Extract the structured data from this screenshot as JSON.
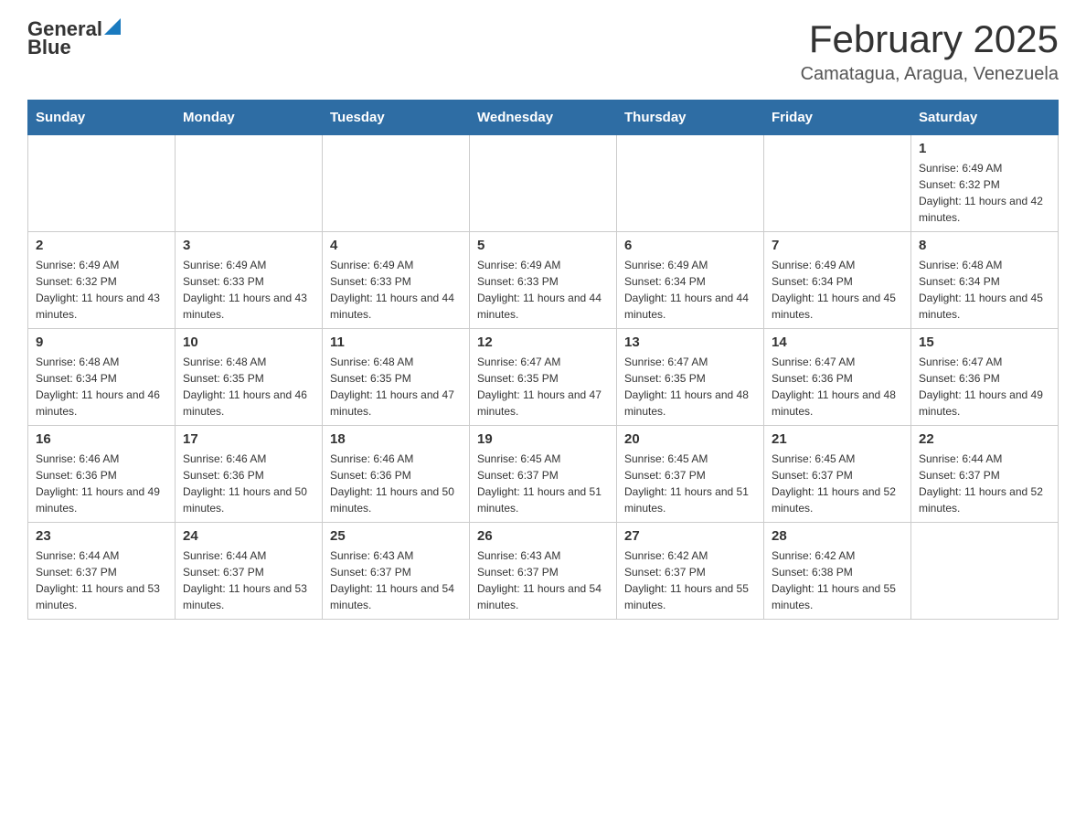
{
  "header": {
    "logo_text_general": "General",
    "logo_text_blue": "Blue",
    "title": "February 2025",
    "location": "Camatagua, Aragua, Venezuela"
  },
  "weekdays": [
    "Sunday",
    "Monday",
    "Tuesday",
    "Wednesday",
    "Thursday",
    "Friday",
    "Saturday"
  ],
  "weeks": [
    [
      {
        "day": "",
        "info": ""
      },
      {
        "day": "",
        "info": ""
      },
      {
        "day": "",
        "info": ""
      },
      {
        "day": "",
        "info": ""
      },
      {
        "day": "",
        "info": ""
      },
      {
        "day": "",
        "info": ""
      },
      {
        "day": "1",
        "info": "Sunrise: 6:49 AM\nSunset: 6:32 PM\nDaylight: 11 hours and 42 minutes."
      }
    ],
    [
      {
        "day": "2",
        "info": "Sunrise: 6:49 AM\nSunset: 6:32 PM\nDaylight: 11 hours and 43 minutes."
      },
      {
        "day": "3",
        "info": "Sunrise: 6:49 AM\nSunset: 6:33 PM\nDaylight: 11 hours and 43 minutes."
      },
      {
        "day": "4",
        "info": "Sunrise: 6:49 AM\nSunset: 6:33 PM\nDaylight: 11 hours and 44 minutes."
      },
      {
        "day": "5",
        "info": "Sunrise: 6:49 AM\nSunset: 6:33 PM\nDaylight: 11 hours and 44 minutes."
      },
      {
        "day": "6",
        "info": "Sunrise: 6:49 AM\nSunset: 6:34 PM\nDaylight: 11 hours and 44 minutes."
      },
      {
        "day": "7",
        "info": "Sunrise: 6:49 AM\nSunset: 6:34 PM\nDaylight: 11 hours and 45 minutes."
      },
      {
        "day": "8",
        "info": "Sunrise: 6:48 AM\nSunset: 6:34 PM\nDaylight: 11 hours and 45 minutes."
      }
    ],
    [
      {
        "day": "9",
        "info": "Sunrise: 6:48 AM\nSunset: 6:34 PM\nDaylight: 11 hours and 46 minutes."
      },
      {
        "day": "10",
        "info": "Sunrise: 6:48 AM\nSunset: 6:35 PM\nDaylight: 11 hours and 46 minutes."
      },
      {
        "day": "11",
        "info": "Sunrise: 6:48 AM\nSunset: 6:35 PM\nDaylight: 11 hours and 47 minutes."
      },
      {
        "day": "12",
        "info": "Sunrise: 6:47 AM\nSunset: 6:35 PM\nDaylight: 11 hours and 47 minutes."
      },
      {
        "day": "13",
        "info": "Sunrise: 6:47 AM\nSunset: 6:35 PM\nDaylight: 11 hours and 48 minutes."
      },
      {
        "day": "14",
        "info": "Sunrise: 6:47 AM\nSunset: 6:36 PM\nDaylight: 11 hours and 48 minutes."
      },
      {
        "day": "15",
        "info": "Sunrise: 6:47 AM\nSunset: 6:36 PM\nDaylight: 11 hours and 49 minutes."
      }
    ],
    [
      {
        "day": "16",
        "info": "Sunrise: 6:46 AM\nSunset: 6:36 PM\nDaylight: 11 hours and 49 minutes."
      },
      {
        "day": "17",
        "info": "Sunrise: 6:46 AM\nSunset: 6:36 PM\nDaylight: 11 hours and 50 minutes."
      },
      {
        "day": "18",
        "info": "Sunrise: 6:46 AM\nSunset: 6:36 PM\nDaylight: 11 hours and 50 minutes."
      },
      {
        "day": "19",
        "info": "Sunrise: 6:45 AM\nSunset: 6:37 PM\nDaylight: 11 hours and 51 minutes."
      },
      {
        "day": "20",
        "info": "Sunrise: 6:45 AM\nSunset: 6:37 PM\nDaylight: 11 hours and 51 minutes."
      },
      {
        "day": "21",
        "info": "Sunrise: 6:45 AM\nSunset: 6:37 PM\nDaylight: 11 hours and 52 minutes."
      },
      {
        "day": "22",
        "info": "Sunrise: 6:44 AM\nSunset: 6:37 PM\nDaylight: 11 hours and 52 minutes."
      }
    ],
    [
      {
        "day": "23",
        "info": "Sunrise: 6:44 AM\nSunset: 6:37 PM\nDaylight: 11 hours and 53 minutes."
      },
      {
        "day": "24",
        "info": "Sunrise: 6:44 AM\nSunset: 6:37 PM\nDaylight: 11 hours and 53 minutes."
      },
      {
        "day": "25",
        "info": "Sunrise: 6:43 AM\nSunset: 6:37 PM\nDaylight: 11 hours and 54 minutes."
      },
      {
        "day": "26",
        "info": "Sunrise: 6:43 AM\nSunset: 6:37 PM\nDaylight: 11 hours and 54 minutes."
      },
      {
        "day": "27",
        "info": "Sunrise: 6:42 AM\nSunset: 6:37 PM\nDaylight: 11 hours and 55 minutes."
      },
      {
        "day": "28",
        "info": "Sunrise: 6:42 AM\nSunset: 6:38 PM\nDaylight: 11 hours and 55 minutes."
      },
      {
        "day": "",
        "info": ""
      }
    ]
  ]
}
